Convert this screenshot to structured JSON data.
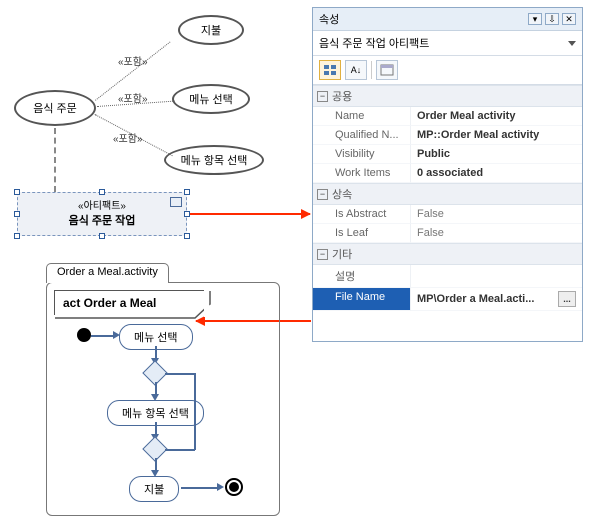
{
  "usecase": {
    "main": "음식 주문",
    "uc1": "지불",
    "uc2": "메뉴 선택",
    "uc3": "메뉴 항목 선택",
    "include_label": "«포함»"
  },
  "artifact": {
    "stereotype": "«아티팩트»",
    "name": "음식 주문 작업"
  },
  "properties": {
    "panel_title": "속성",
    "object_label": "음식 주문 작업 아티팩트",
    "cat_common": "공용",
    "cat_inherit": "상속",
    "cat_other": "기타",
    "rows": {
      "name_lbl": "Name",
      "name_val": "Order Meal activity",
      "qn_lbl": "Qualified N...",
      "qn_val": "MP::Order Meal activity",
      "vis_lbl": "Visibility",
      "vis_val": "Public",
      "wi_lbl": "Work Items",
      "wi_val": "0 associated",
      "abs_lbl": "Is Abstract",
      "abs_val": "False",
      "leaf_lbl": "Is Leaf",
      "leaf_val": "False",
      "desc_lbl": "설명",
      "desc_val": "",
      "file_lbl": "File Name",
      "file_val": "MP\\Order a Meal.acti..."
    }
  },
  "activity": {
    "tab": "Order a Meal.activity",
    "heading": "act Order a Meal",
    "n1": "메뉴 선택",
    "n2": "메뉴 항목 선택",
    "n3": "지불"
  },
  "icons": {
    "expand": "⊟",
    "sort": "A↓",
    "more": "...",
    "dropdown": "▾",
    "pin": "📌",
    "close": "✕"
  }
}
